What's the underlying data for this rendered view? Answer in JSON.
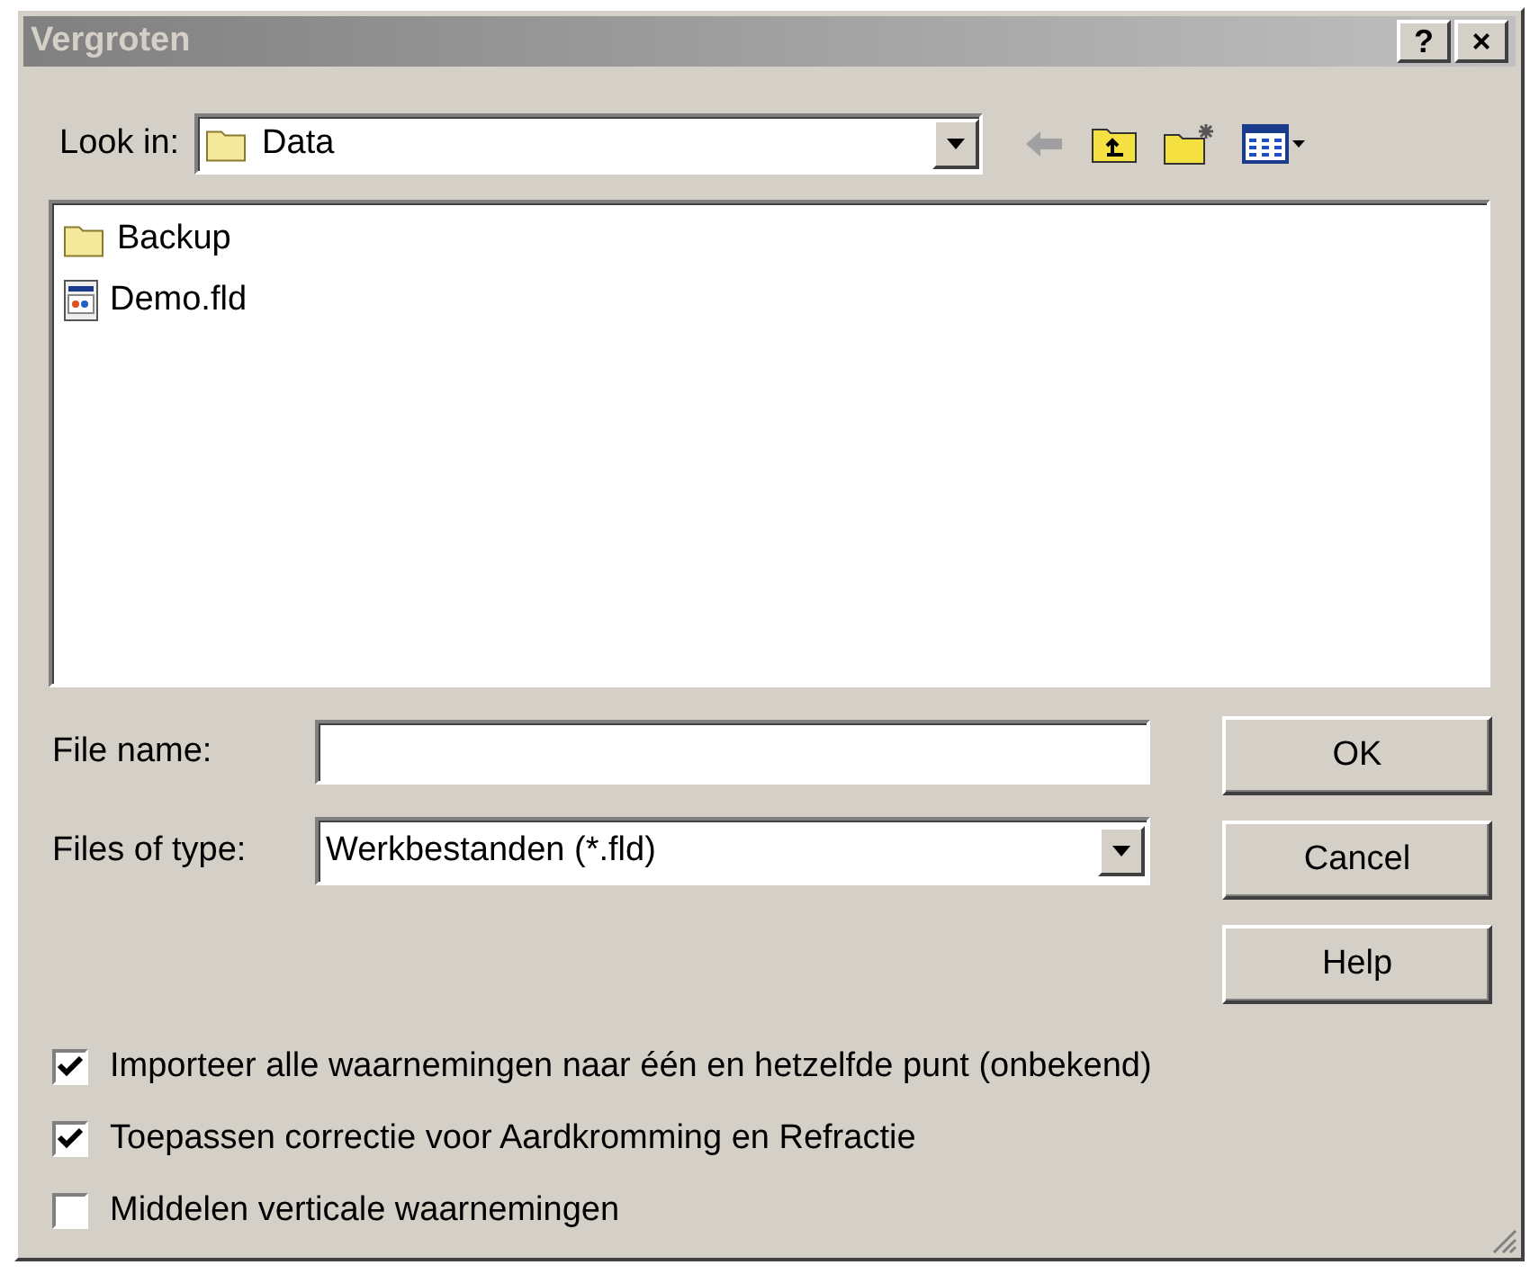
{
  "window": {
    "title": "Vergroten",
    "title_buttons": [
      "?",
      "×"
    ],
    "active": false
  },
  "look_in": {
    "label": "Look in:",
    "value": "Data"
  },
  "files": [
    {
      "name": "Backup",
      "kind": "folder",
      "selected": false
    },
    {
      "name": "Demo.fld",
      "kind": "file",
      "selected": false
    }
  ],
  "file_name": {
    "label": "File name:"
  },
  "file_type": {
    "label": "Files of type:",
    "value": "Werkbestanden (*.fld)"
  },
  "buttons": [
    "OK",
    "Cancel",
    "Help"
  ],
  "options": [
    {
      "label": "Importeer alle waarnemingen naar één en hetzelfde punt (onbekend)",
      "checked": true
    },
    {
      "label": "Toepassen correctie voor Aardkromming en Refractie",
      "checked": true
    },
    {
      "label": "Middelen verticale waarnemingen",
      "checked": false
    }
  ]
}
